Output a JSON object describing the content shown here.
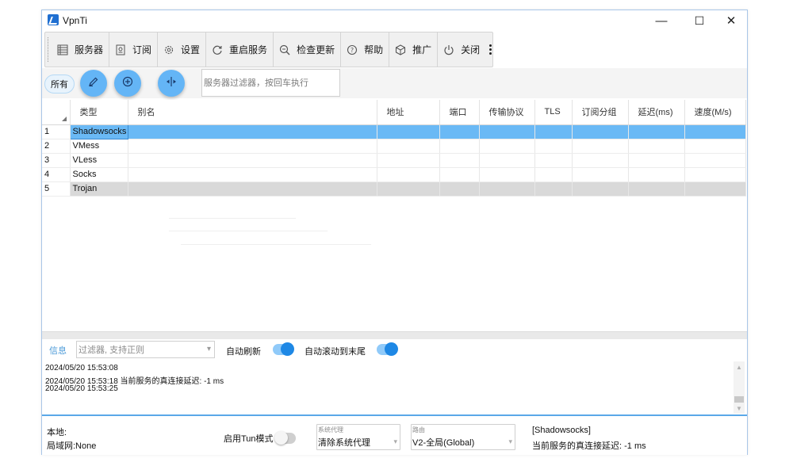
{
  "window": {
    "title": "VpnTi",
    "controls": {
      "minimize": "—",
      "maximize": "☐",
      "close": "✕"
    }
  },
  "toolbar": {
    "items": [
      {
        "label": "服务器",
        "icon": "server-list-icon"
      },
      {
        "label": "订阅",
        "icon": "subscription-icon"
      },
      {
        "label": "设置",
        "icon": "gear-icon"
      },
      {
        "label": "重启服务",
        "icon": "restart-icon"
      },
      {
        "label": "检查更新",
        "icon": "check-update-icon"
      },
      {
        "label": "帮助",
        "icon": "help-icon"
      },
      {
        "label": "推广",
        "icon": "promote-icon"
      },
      {
        "label": "关闭",
        "icon": "power-icon"
      }
    ]
  },
  "quickbar": {
    "all_label": "所有",
    "filter_placeholder": "服务器过滤器，按回车执行"
  },
  "grid": {
    "columns": [
      "类型",
      "别名",
      "地址",
      "端口",
      "传输协议",
      "TLS",
      "订阅分组",
      "延迟(ms)",
      "速度(M/s)"
    ],
    "rows": [
      {
        "num": "1",
        "type": "Shadowsocks"
      },
      {
        "num": "2",
        "type": "VMess"
      },
      {
        "num": "3",
        "type": "VLess"
      },
      {
        "num": "4",
        "type": "Socks"
      },
      {
        "num": "5",
        "type": "Trojan"
      }
    ]
  },
  "log": {
    "label": "信息",
    "filter_placeholder": "过滤器, 支持正则",
    "auto_refresh_label": "自动刷新",
    "auto_scroll_label": "自动滚动到末尾",
    "lines": [
      "2024/05/20 15:53:08",
      "2024/05/20 15:53:18 当前服务的真连接延迟: -1 ms",
      "2024/05/20 15:53:25"
    ]
  },
  "status": {
    "local_label": "本地:",
    "lan_label": "局域网:None",
    "tun_label": "启用Tun模式",
    "system_proxy_caption": "系统代理",
    "system_proxy_value": "清除系统代理",
    "routing_caption": "路由",
    "routing_value": "V2-全局(Global)",
    "current_server": "[Shadowsocks]",
    "current_delay": "当前服务的真连接延迟: -1 ms"
  },
  "colors": {
    "accent": "#1e88e5",
    "selected_row": "#6ab9f5",
    "fab": "#64b5f6"
  }
}
